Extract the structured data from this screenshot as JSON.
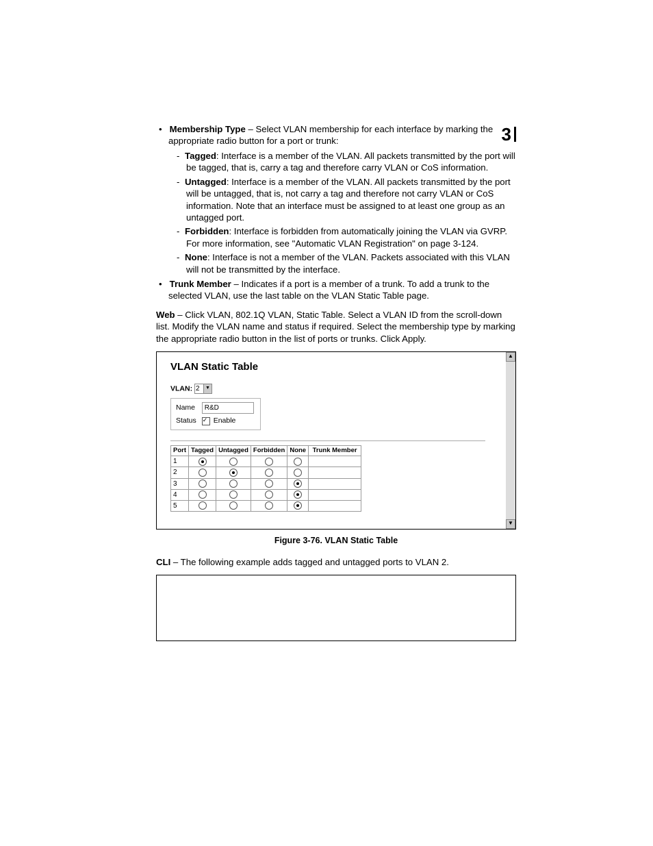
{
  "chapter_number": "3",
  "bullets": {
    "membership_type": {
      "term": "Membership Type",
      "desc": " – Select VLAN membership for each interface by marking the appropriate radio button for a port or trunk:",
      "items": [
        {
          "term": "Tagged",
          "desc": ": Interface is a member of the VLAN. All packets transmitted by the port will be tagged, that is, carry a tag and therefore carry VLAN or CoS information."
        },
        {
          "term": "Untagged",
          "desc": ": Interface is a member of the VLAN. All packets transmitted by the port will be untagged, that is, not carry a tag and therefore not carry VLAN or CoS information. Note that an interface must be assigned to at least one group as an untagged port."
        },
        {
          "term": "Forbidden",
          "desc": ": Interface is forbidden from automatically joining the VLAN via GVRP. For more information, see \"Automatic VLAN Registration\" on page 3-124."
        },
        {
          "term": "None",
          "desc": ": Interface is not a member of the VLAN. Packets associated with this VLAN will not be transmitted by the interface."
        }
      ]
    },
    "trunk_member": {
      "term": "Trunk Member",
      "desc": " – Indicates if a port is a member of a trunk. To add a trunk to the selected VLAN, use the last table on the VLAN Static Table page."
    }
  },
  "web_para_lead": "Web",
  "web_para_rest": " – Click VLAN, 802.1Q VLAN, Static Table. Select a VLAN ID from the scroll-down list. Modify the VLAN name and status if required. Select the membership type by marking the appropriate radio button in the list of ports or trunks. Click Apply.",
  "figure": {
    "title": "VLAN Static Table",
    "vlan_label": "VLAN:",
    "vlan_value": "2",
    "name_label": "Name",
    "name_value": "R&D",
    "status_label": "Status",
    "enable_label": "Enable",
    "status_checked": true,
    "columns": [
      "Port",
      "Tagged",
      "Untagged",
      "Forbidden",
      "None",
      "Trunk Member"
    ],
    "rows": [
      {
        "port": "1",
        "selected": "Tagged"
      },
      {
        "port": "2",
        "selected": "Untagged"
      },
      {
        "port": "3",
        "selected": "None"
      },
      {
        "port": "4",
        "selected": "None"
      },
      {
        "port": "5",
        "selected": "None"
      }
    ]
  },
  "caption": "Figure 3-76.  VLAN Static Table",
  "cli_lead": "CLI",
  "cli_rest": " – The following example adds tagged and untagged ports to VLAN 2."
}
